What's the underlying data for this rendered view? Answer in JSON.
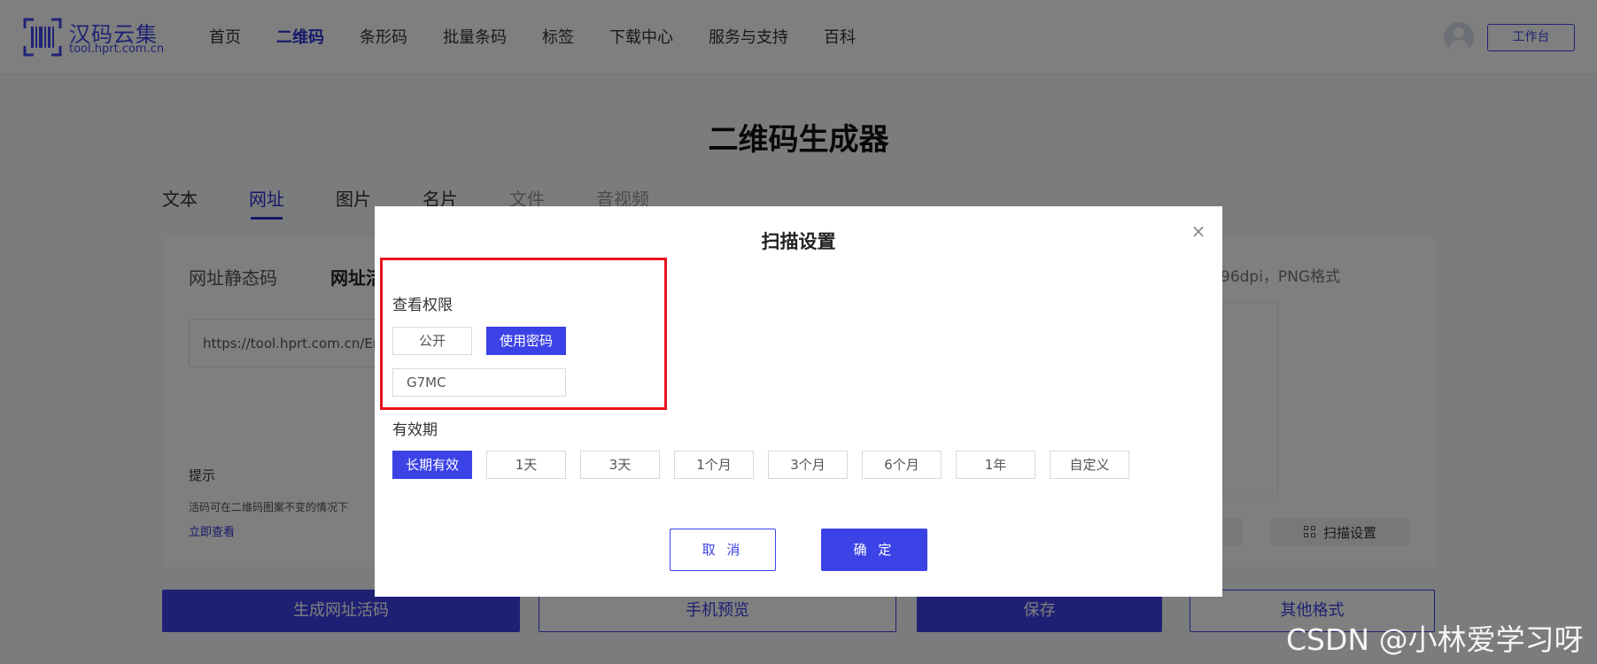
{
  "header": {
    "logo_title": "汉码云集",
    "logo_sub": "tool.hprt.com.cn",
    "nav": [
      {
        "label": "首页",
        "active": false
      },
      {
        "label": "二维码",
        "active": true
      },
      {
        "label": "条形码",
        "active": false
      },
      {
        "label": "批量条码",
        "active": false
      },
      {
        "label": "标签",
        "active": false
      },
      {
        "label": "下载中心",
        "active": false
      },
      {
        "label": "服务与支持",
        "active": false
      },
      {
        "label": "百科",
        "active": false
      }
    ],
    "workbench_label": "工作台"
  },
  "page": {
    "title": "二维码生成器",
    "type_tabs": [
      "文本",
      "网址",
      "图片",
      "名片",
      "文件",
      "音视频"
    ],
    "subtab_static": "网址静态码",
    "subtab_live": "网址活",
    "url_value": "https://tool.hprt.com.cn/ErW",
    "tip_title": "提示",
    "tip_text": "活码可在二维码图案不变的情况下",
    "tip_link": "立即查看",
    "right_info": "96dpi，PNG格式",
    "scan_settings_label": "扫描设置"
  },
  "actions": {
    "generate": "生成网址活码",
    "preview": "手机预览",
    "save": "保存",
    "other_formats": "其他格式"
  },
  "modal": {
    "title": "扫描设置",
    "close_icon": "close-icon",
    "permission_label": "查看权限",
    "permission_options": [
      {
        "label": "公开",
        "selected": false
      },
      {
        "label": "使用密码",
        "selected": true
      }
    ],
    "password_value": "G7MC",
    "validity_label": "有效期",
    "validity_options": [
      {
        "label": "长期有效",
        "selected": true
      },
      {
        "label": "1天",
        "selected": false
      },
      {
        "label": "3天",
        "selected": false
      },
      {
        "label": "1个月",
        "selected": false
      },
      {
        "label": "3个月",
        "selected": false
      },
      {
        "label": "6个月",
        "selected": false
      },
      {
        "label": "1年",
        "selected": false
      },
      {
        "label": "自定义",
        "selected": false
      }
    ],
    "cancel_label": "取 消",
    "ok_label": "确 定"
  },
  "watermark": "CSDN @小林爱学习呀",
  "colors": {
    "brand": "#3c43e6",
    "highlight": "#e8141c"
  }
}
